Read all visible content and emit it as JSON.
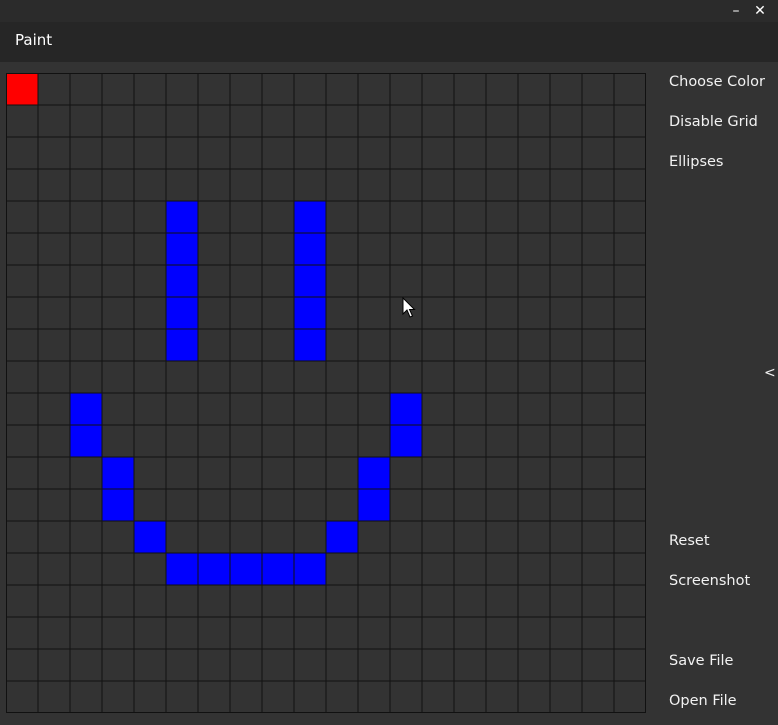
{
  "window": {
    "minimize_glyph": "–",
    "close_glyph": "✕"
  },
  "app": {
    "title": "Paint"
  },
  "sidebar": {
    "choose_color": "Choose Color",
    "disable_grid": "Disable Grid",
    "ellipses": "Ellipses",
    "collapse_glyph": "<",
    "reset": "Reset",
    "screenshot": "Screenshot",
    "save_file": "Save File",
    "open_file": "Open File"
  },
  "grid": {
    "columns": 20,
    "rows": 20,
    "background_color": "#333333",
    "line_color": "#111111",
    "painted_cells": [
      {
        "row": 0,
        "col": 0,
        "color": "#ff0000"
      },
      {
        "row": 4,
        "col": 5,
        "color": "#0000ff"
      },
      {
        "row": 5,
        "col": 5,
        "color": "#0000ff"
      },
      {
        "row": 6,
        "col": 5,
        "color": "#0000ff"
      },
      {
        "row": 7,
        "col": 5,
        "color": "#0000ff"
      },
      {
        "row": 8,
        "col": 5,
        "color": "#0000ff"
      },
      {
        "row": 4,
        "col": 9,
        "color": "#0000ff"
      },
      {
        "row": 5,
        "col": 9,
        "color": "#0000ff"
      },
      {
        "row": 6,
        "col": 9,
        "color": "#0000ff"
      },
      {
        "row": 7,
        "col": 9,
        "color": "#0000ff"
      },
      {
        "row": 8,
        "col": 9,
        "color": "#0000ff"
      },
      {
        "row": 10,
        "col": 2,
        "color": "#0000ff"
      },
      {
        "row": 11,
        "col": 2,
        "color": "#0000ff"
      },
      {
        "row": 10,
        "col": 12,
        "color": "#0000ff"
      },
      {
        "row": 11,
        "col": 12,
        "color": "#0000ff"
      },
      {
        "row": 12,
        "col": 3,
        "color": "#0000ff"
      },
      {
        "row": 13,
        "col": 3,
        "color": "#0000ff"
      },
      {
        "row": 12,
        "col": 11,
        "color": "#0000ff"
      },
      {
        "row": 13,
        "col": 11,
        "color": "#0000ff"
      },
      {
        "row": 14,
        "col": 4,
        "color": "#0000ff"
      },
      {
        "row": 14,
        "col": 10,
        "color": "#0000ff"
      },
      {
        "row": 15,
        "col": 5,
        "color": "#0000ff"
      },
      {
        "row": 15,
        "col": 6,
        "color": "#0000ff"
      },
      {
        "row": 15,
        "col": 7,
        "color": "#0000ff"
      },
      {
        "row": 15,
        "col": 8,
        "color": "#0000ff"
      },
      {
        "row": 15,
        "col": 9,
        "color": "#0000ff"
      }
    ]
  }
}
